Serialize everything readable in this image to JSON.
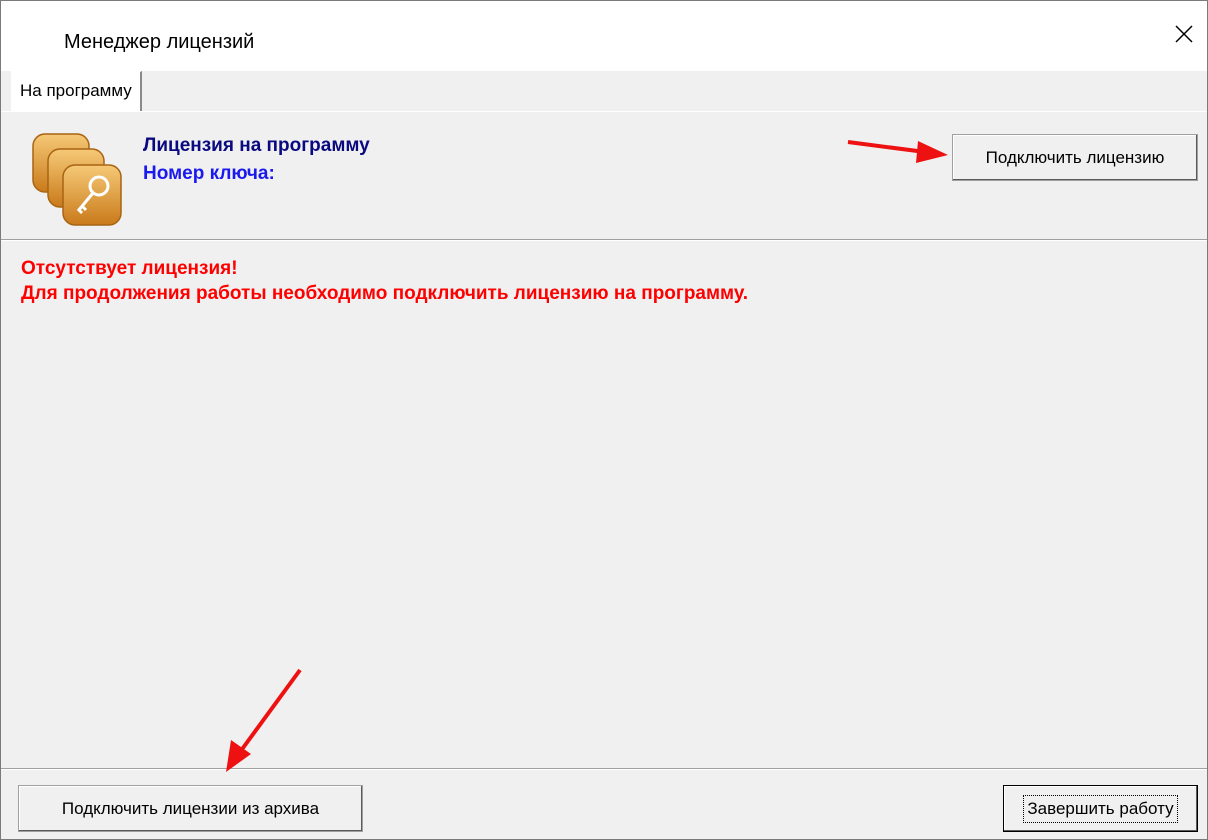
{
  "window": {
    "title": "Менеджер лицензий"
  },
  "tabs": [
    {
      "label": "На программу",
      "active": true
    }
  ],
  "header": {
    "license_title": "Лицензия на программу",
    "key_label": "Номер ключа:",
    "icon": "license-keys-icon",
    "connect_button_label": "Подключить лицензию"
  },
  "messages": {
    "line1": "Отсутствует лицензия!",
    "line2": "Для продолжения работы необходимо подключить лицензию на программу."
  },
  "footer": {
    "archive_button_label": "Подключить лицензии из архива",
    "exit_button_label": "Завершить работу"
  },
  "colors": {
    "license_title": "#0a0a80",
    "key_label": "#1a1aee",
    "error_text": "#ff0000",
    "annotation_arrow": "#ee1111",
    "icon_orange": "#e8a33c"
  }
}
